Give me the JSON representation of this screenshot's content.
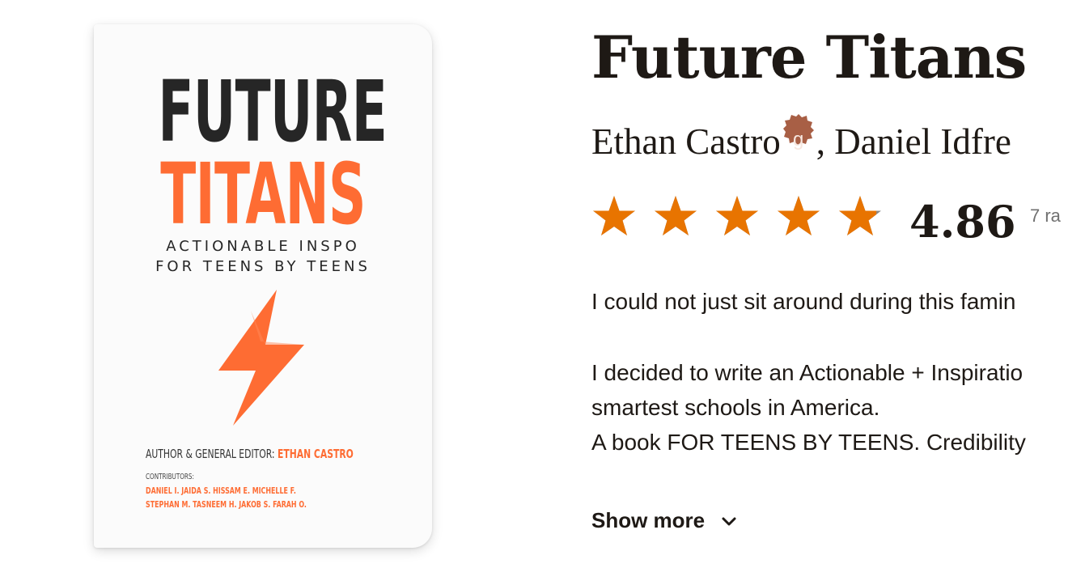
{
  "book": {
    "title": "Future Titans",
    "authors": [
      {
        "name": "Ethan Castro",
        "badge_letter": "g"
      },
      {
        "name": "Daniel Idfre"
      }
    ],
    "author_separator": ",",
    "rating": {
      "value": "4.86",
      "stars": 4.86,
      "max_stars": 5,
      "count_label": "7 ra"
    },
    "description": [
      "I could not just sit around during this famin",
      "I decided to write an Actionable + Inspiratio",
      "smartest schools in America.",
      "A book FOR TEENS BY TEENS. Credibility"
    ],
    "show_more_label": "Show more"
  },
  "cover": {
    "title_line1": "FUTURE",
    "title_line2": "TITANS",
    "subtitle_line1": "ACTIONABLE INSPO",
    "subtitle_line2": "FOR TEENS BY TEENS",
    "editor_label": "AUTHOR & GENERAL EDITOR:",
    "editor_name": "ETHAN CASTRO",
    "contributors_label": "CONTRIBUTORS:",
    "contributors_line1": "DANIEL I.  JAIDA S.  HISSAM E.  MICHELLE F.",
    "contributors_line2": "STEPHAN M.  TASNEEM H.  JAKOB S.  FARAH O."
  },
  "colors": {
    "star": "#e87400",
    "star_empty": "#8a8a8a",
    "badge": "#a85f45",
    "cover_orange": "#fe6c33",
    "text": "#1e1915"
  },
  "icons": {
    "star": "star-icon",
    "badge": "goodreads-author-badge-icon",
    "chevron": "chevron-down-icon",
    "bolt": "lightning-bolt-icon"
  }
}
